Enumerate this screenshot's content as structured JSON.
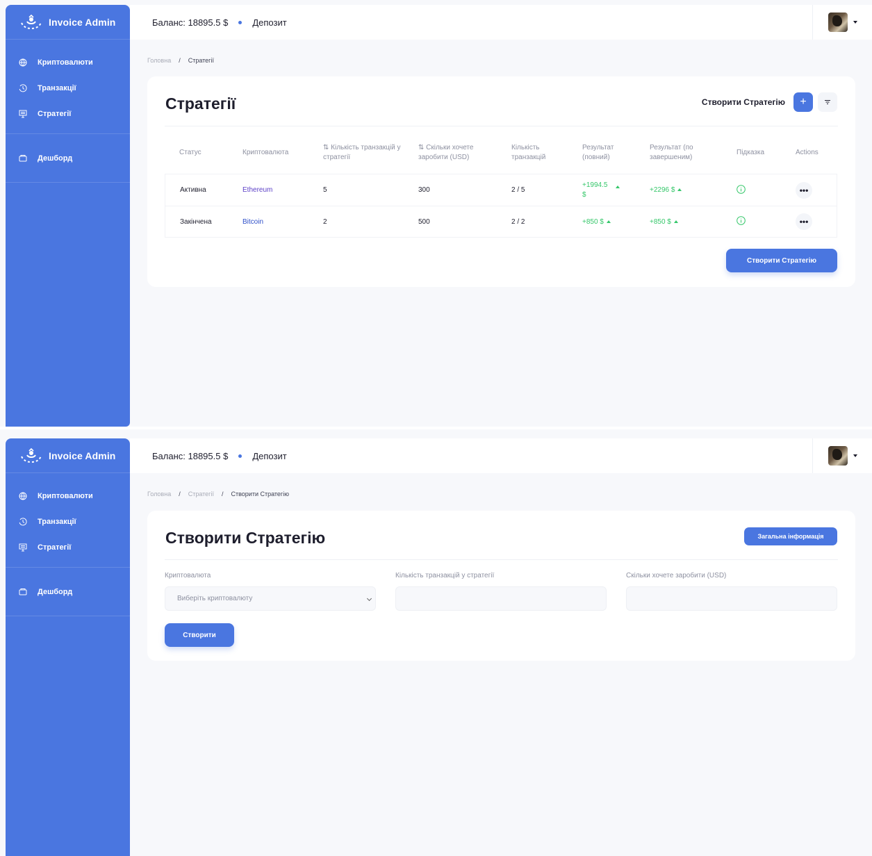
{
  "app": {
    "brand": "Invoice Admin",
    "balance": "Баланс: 18895.5 $",
    "deposit": "Депозит"
  },
  "sidebar": {
    "items": [
      {
        "label": "Криптовалюти",
        "icon": "globe-icon"
      },
      {
        "label": "Транзакції",
        "icon": "clock-icon"
      },
      {
        "label": "Стратегії",
        "icon": "monitor-icon"
      }
    ],
    "dashboard": {
      "label": "Дешборд",
      "icon": "folder-icon"
    }
  },
  "screen1": {
    "breadcrumb": {
      "home": "Головна",
      "separator": "/",
      "current": "Стратегії"
    },
    "title": "Стратегії",
    "create_label": "Створити Стратегію",
    "plus": "+",
    "table": {
      "headers": [
        "Статус",
        "Криптовалюта",
        "⇅ Кількість транзакцій у стратегії",
        "⇅ Скільки хочете заробити (USD)",
        "Кількість транзакцій",
        "Результат (повний)",
        "Результат (по завершеним)",
        "Підказка",
        "Actions"
      ],
      "rows": [
        {
          "status": "Активна",
          "crypto": "Ethereum",
          "tx_count": "5",
          "earn": "300",
          "tx_progress": "2 / 5",
          "result_full": "+1994.5 $",
          "result_done": "+2296 $"
        },
        {
          "status": "Закінчена",
          "crypto": "Bitcoin",
          "tx_count": "2",
          "earn": "500",
          "tx_progress": "2 / 2",
          "result_full": "+850 $",
          "result_done": "+850 $"
        }
      ],
      "actions": "•••"
    },
    "create_button": "Створити Стратегію"
  },
  "screen2": {
    "breadcrumb": {
      "home": "Головна",
      "middle": "Стратегії",
      "separator": "/",
      "current": "Створити Стратегію"
    },
    "title": "Створити Стратегію",
    "info_button": "Загальна інформація",
    "form": {
      "crypto_label": "Криптовалюта",
      "crypto_placeholder": "Виберіть криптовалюту",
      "tx_label": "Кількість транзакцій у стратегії",
      "earn_label": "Скільки хочете заробити (USD)"
    },
    "submit": "Створити"
  },
  "colors": {
    "primary": "#4a76e0",
    "success": "#35c76a",
    "link": "#5b3fc7"
  }
}
